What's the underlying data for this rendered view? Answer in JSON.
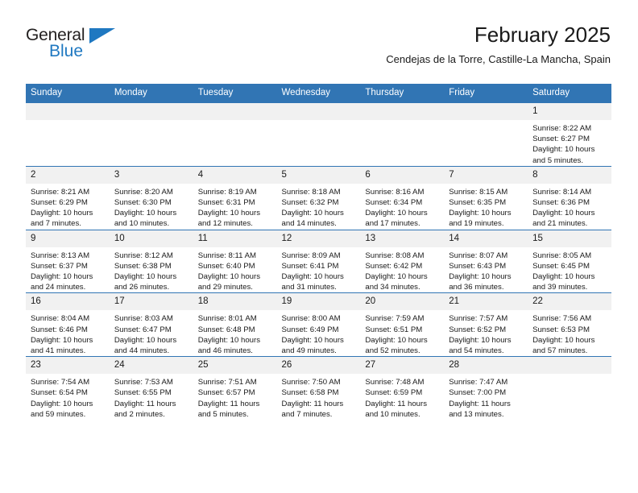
{
  "brand": {
    "name_top": "General",
    "name_bottom": "Blue",
    "accent_color": "#1f78c1"
  },
  "header": {
    "title": "February 2025",
    "subtitle": "Cendejas de la Torre, Castille-La Mancha, Spain"
  },
  "calendar": {
    "header_background": "#3175b4",
    "header_text_color": "#ffffff",
    "daynum_background": "#f1f1f1",
    "weekdays": [
      "Sunday",
      "Monday",
      "Tuesday",
      "Wednesday",
      "Thursday",
      "Friday",
      "Saturday"
    ],
    "labels": {
      "sunrise": "Sunrise:",
      "sunset": "Sunset:",
      "daylight": "Daylight:"
    },
    "weeks": [
      [
        {
          "day": "",
          "blank": true
        },
        {
          "day": "",
          "blank": true
        },
        {
          "day": "",
          "blank": true
        },
        {
          "day": "",
          "blank": true
        },
        {
          "day": "",
          "blank": true
        },
        {
          "day": "",
          "blank": true
        },
        {
          "day": "1",
          "sunrise": "Sunrise: 8:22 AM",
          "sunset": "Sunset: 6:27 PM",
          "daylight": "Daylight: 10 hours and 5 minutes."
        }
      ],
      [
        {
          "day": "2",
          "sunrise": "Sunrise: 8:21 AM",
          "sunset": "Sunset: 6:29 PM",
          "daylight": "Daylight: 10 hours and 7 minutes."
        },
        {
          "day": "3",
          "sunrise": "Sunrise: 8:20 AM",
          "sunset": "Sunset: 6:30 PM",
          "daylight": "Daylight: 10 hours and 10 minutes."
        },
        {
          "day": "4",
          "sunrise": "Sunrise: 8:19 AM",
          "sunset": "Sunset: 6:31 PM",
          "daylight": "Daylight: 10 hours and 12 minutes."
        },
        {
          "day": "5",
          "sunrise": "Sunrise: 8:18 AM",
          "sunset": "Sunset: 6:32 PM",
          "daylight": "Daylight: 10 hours and 14 minutes."
        },
        {
          "day": "6",
          "sunrise": "Sunrise: 8:16 AM",
          "sunset": "Sunset: 6:34 PM",
          "daylight": "Daylight: 10 hours and 17 minutes."
        },
        {
          "day": "7",
          "sunrise": "Sunrise: 8:15 AM",
          "sunset": "Sunset: 6:35 PM",
          "daylight": "Daylight: 10 hours and 19 minutes."
        },
        {
          "day": "8",
          "sunrise": "Sunrise: 8:14 AM",
          "sunset": "Sunset: 6:36 PM",
          "daylight": "Daylight: 10 hours and 21 minutes."
        }
      ],
      [
        {
          "day": "9",
          "sunrise": "Sunrise: 8:13 AM",
          "sunset": "Sunset: 6:37 PM",
          "daylight": "Daylight: 10 hours and 24 minutes."
        },
        {
          "day": "10",
          "sunrise": "Sunrise: 8:12 AM",
          "sunset": "Sunset: 6:38 PM",
          "daylight": "Daylight: 10 hours and 26 minutes."
        },
        {
          "day": "11",
          "sunrise": "Sunrise: 8:11 AM",
          "sunset": "Sunset: 6:40 PM",
          "daylight": "Daylight: 10 hours and 29 minutes."
        },
        {
          "day": "12",
          "sunrise": "Sunrise: 8:09 AM",
          "sunset": "Sunset: 6:41 PM",
          "daylight": "Daylight: 10 hours and 31 minutes."
        },
        {
          "day": "13",
          "sunrise": "Sunrise: 8:08 AM",
          "sunset": "Sunset: 6:42 PM",
          "daylight": "Daylight: 10 hours and 34 minutes."
        },
        {
          "day": "14",
          "sunrise": "Sunrise: 8:07 AM",
          "sunset": "Sunset: 6:43 PM",
          "daylight": "Daylight: 10 hours and 36 minutes."
        },
        {
          "day": "15",
          "sunrise": "Sunrise: 8:05 AM",
          "sunset": "Sunset: 6:45 PM",
          "daylight": "Daylight: 10 hours and 39 minutes."
        }
      ],
      [
        {
          "day": "16",
          "sunrise": "Sunrise: 8:04 AM",
          "sunset": "Sunset: 6:46 PM",
          "daylight": "Daylight: 10 hours and 41 minutes."
        },
        {
          "day": "17",
          "sunrise": "Sunrise: 8:03 AM",
          "sunset": "Sunset: 6:47 PM",
          "daylight": "Daylight: 10 hours and 44 minutes."
        },
        {
          "day": "18",
          "sunrise": "Sunrise: 8:01 AM",
          "sunset": "Sunset: 6:48 PM",
          "daylight": "Daylight: 10 hours and 46 minutes."
        },
        {
          "day": "19",
          "sunrise": "Sunrise: 8:00 AM",
          "sunset": "Sunset: 6:49 PM",
          "daylight": "Daylight: 10 hours and 49 minutes."
        },
        {
          "day": "20",
          "sunrise": "Sunrise: 7:59 AM",
          "sunset": "Sunset: 6:51 PM",
          "daylight": "Daylight: 10 hours and 52 minutes."
        },
        {
          "day": "21",
          "sunrise": "Sunrise: 7:57 AM",
          "sunset": "Sunset: 6:52 PM",
          "daylight": "Daylight: 10 hours and 54 minutes."
        },
        {
          "day": "22",
          "sunrise": "Sunrise: 7:56 AM",
          "sunset": "Sunset: 6:53 PM",
          "daylight": "Daylight: 10 hours and 57 minutes."
        }
      ],
      [
        {
          "day": "23",
          "sunrise": "Sunrise: 7:54 AM",
          "sunset": "Sunset: 6:54 PM",
          "daylight": "Daylight: 10 hours and 59 minutes."
        },
        {
          "day": "24",
          "sunrise": "Sunrise: 7:53 AM",
          "sunset": "Sunset: 6:55 PM",
          "daylight": "Daylight: 11 hours and 2 minutes."
        },
        {
          "day": "25",
          "sunrise": "Sunrise: 7:51 AM",
          "sunset": "Sunset: 6:57 PM",
          "daylight": "Daylight: 11 hours and 5 minutes."
        },
        {
          "day": "26",
          "sunrise": "Sunrise: 7:50 AM",
          "sunset": "Sunset: 6:58 PM",
          "daylight": "Daylight: 11 hours and 7 minutes."
        },
        {
          "day": "27",
          "sunrise": "Sunrise: 7:48 AM",
          "sunset": "Sunset: 6:59 PM",
          "daylight": "Daylight: 11 hours and 10 minutes."
        },
        {
          "day": "28",
          "sunrise": "Sunrise: 7:47 AM",
          "sunset": "Sunset: 7:00 PM",
          "daylight": "Daylight: 11 hours and 13 minutes."
        },
        {
          "day": "",
          "blank": true
        }
      ]
    ]
  }
}
